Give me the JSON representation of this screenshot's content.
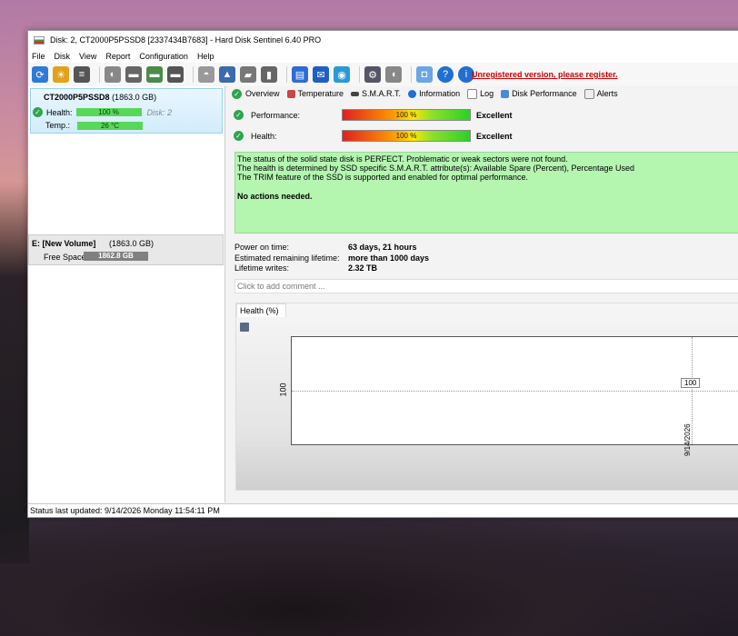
{
  "window": {
    "title": "Disk: 2, CT2000P5PSSD8 [2337434B7683]  -  Hard Disk Sentinel 6.40 PRO"
  },
  "menu": [
    "File",
    "Disk",
    "View",
    "Report",
    "Configuration",
    "Help"
  ],
  "toolbar": {
    "unregistered_text": "Unregistered version, please register."
  },
  "left_panel": {
    "disk": {
      "name": "CT2000P5PSSD8",
      "size": "(1863.0 GB)",
      "health_label": "Health:",
      "health_value": "100 %",
      "disk_number": "Disk: 2",
      "temp_label": "Temp.:",
      "temp_value": "26 °C"
    },
    "volume": {
      "name": "E: [New Volume]",
      "size": "(1863.0 GB)",
      "free_label": "Free Space",
      "free_value": "1862.8 GB"
    }
  },
  "tabs": [
    "Overview",
    "Temperature",
    "S.M.A.R.T.",
    "Information",
    "Log",
    "Disk Performance",
    "Alerts"
  ],
  "overview": {
    "performance_label": "Performance:",
    "performance_value": "100 %",
    "performance_rating": "Excellent",
    "health_label": "Health:",
    "health_value": "100 %",
    "health_rating": "Excellent",
    "status_lines": [
      "The status of the solid state disk is PERFECT. Problematic or weak sectors were not found.",
      "The health is determined by SSD specific S.M.A.R.T. attribute(s):  Available Spare (Percent), Percentage Used",
      "The TRIM feature of the SSD is supported and enabled for optimal performance."
    ],
    "status_action": "No actions needed.",
    "info_rows": [
      {
        "label": "Power on time:",
        "value": "63 days, 21 hours"
      },
      {
        "label": "Estimated remaining lifetime:",
        "value": "more than 1000 days"
      },
      {
        "label": "Lifetime writes:",
        "value": "2.32 TB"
      }
    ],
    "comment_placeholder": "Click to add comment ...",
    "chart_tab": "Health (%)"
  },
  "chart_data": {
    "type": "line",
    "x": [
      "9/14/2026"
    ],
    "values": [
      100
    ],
    "ylabel": "100",
    "point_label": "100"
  },
  "statusbar": {
    "text": "Status last updated: 9/14/2026 Monday 11:54:11 PM"
  }
}
